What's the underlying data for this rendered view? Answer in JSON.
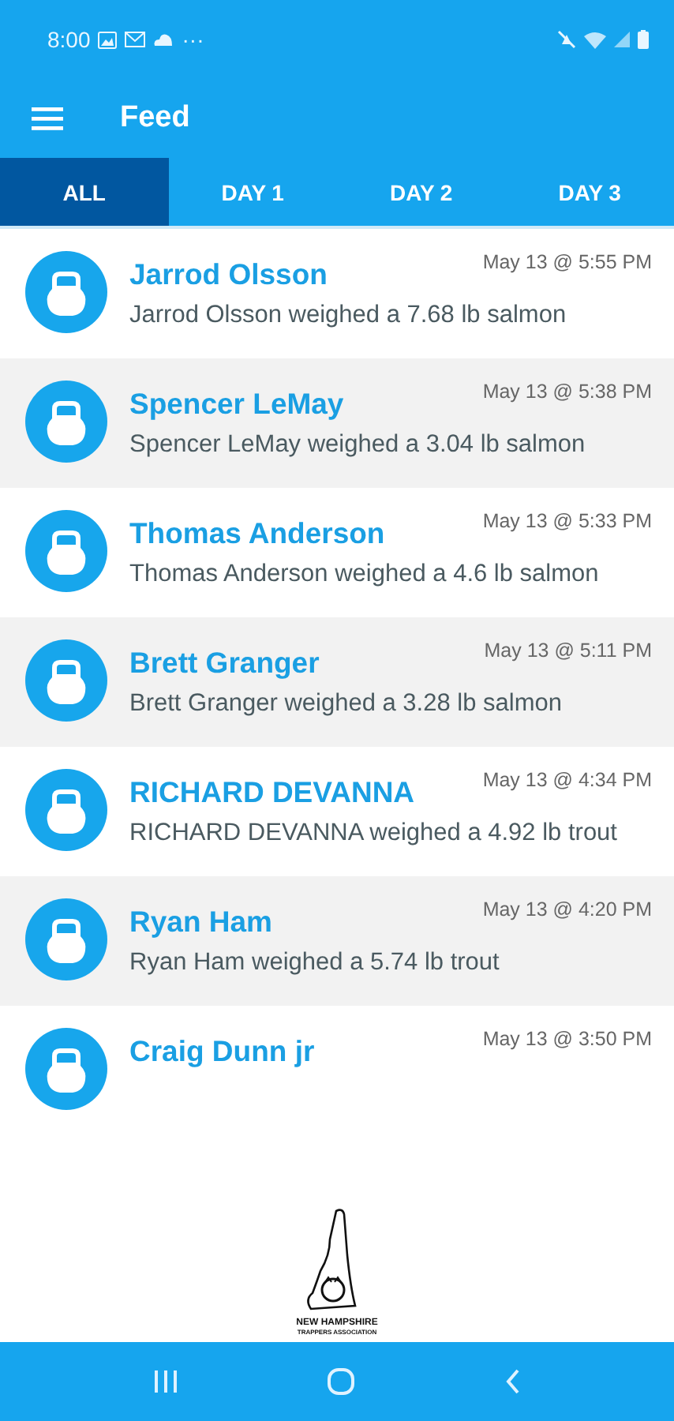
{
  "status_bar": {
    "time": "8:00",
    "more": "···"
  },
  "toolbar": {
    "title": "Feed"
  },
  "tabs": [
    {
      "label": "ALL",
      "selected": true
    },
    {
      "label": "DAY 1",
      "selected": false
    },
    {
      "label": "DAY 2",
      "selected": false
    },
    {
      "label": "DAY 3",
      "selected": false
    }
  ],
  "feed": [
    {
      "name": "Jarrod Olsson",
      "time": "May 13 @ 5:55 PM",
      "text": "Jarrod Olsson weighed a 7.68 lb salmon"
    },
    {
      "name": "Spencer LeMay",
      "time": "May 13 @ 5:38 PM",
      "text": "Spencer LeMay weighed a 3.04 lb salmon"
    },
    {
      "name": "Thomas Anderson",
      "time": "May 13 @ 5:33 PM",
      "text": "Thomas Anderson weighed a 4.6 lb salmon"
    },
    {
      "name": "Brett Granger",
      "time": "May 13 @ 5:11 PM",
      "text": "Brett Granger weighed a 3.28 lb salmon"
    },
    {
      "name": "RICHARD DEVANNA",
      "time": "May 13 @ 4:34 PM",
      "text": "RICHARD DEVANNA weighed a 4.92 lb trout"
    },
    {
      "name": "Ryan Ham",
      "time": "May 13 @ 4:20 PM",
      "text": "Ryan Ham weighed a 5.74 lb trout"
    },
    {
      "name": "Craig Dunn jr",
      "time": "May 13 @ 3:50 PM"
    }
  ],
  "logo": {
    "line_1": "NEW HAMPSHIRE",
    "line_2": "TRAPPERS ASSOCIATION"
  }
}
